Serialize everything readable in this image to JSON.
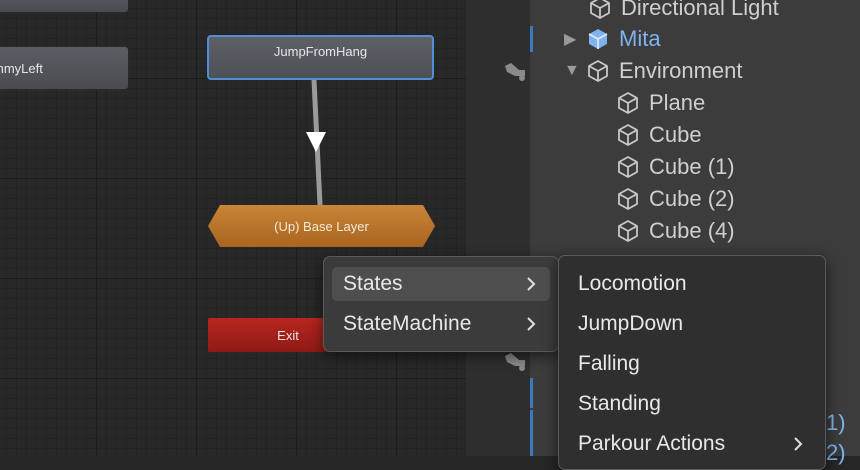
{
  "animator": {
    "nodes": {
      "top_partial": "",
      "left_partial": "mmyLeft",
      "jump_from_hang": "JumpFromHang",
      "base_layer": "(Up) Base Layer",
      "exit": "Exit"
    }
  },
  "hierarchy": {
    "items": [
      {
        "label": "Directional Light"
      },
      {
        "label": "Mita"
      },
      {
        "label": "Environment"
      },
      {
        "label": "Plane"
      },
      {
        "label": "Cube"
      },
      {
        "label": "Cube (1)"
      },
      {
        "label": "Cube (2)"
      },
      {
        "label": "Cube (4)"
      }
    ],
    "edge_fragments": [
      "1)",
      "2)"
    ],
    "colors": {
      "prefab_blue": "#7fb2ee",
      "selection_bar": "#3a79c2"
    }
  },
  "context_menu": {
    "items": [
      {
        "label": "States"
      },
      {
        "label": "StateMachine"
      }
    ],
    "submenu": {
      "items": [
        {
          "label": "Locomotion"
        },
        {
          "label": "JumpDown"
        },
        {
          "label": "Falling"
        },
        {
          "label": "Standing"
        },
        {
          "label": "Parkour Actions"
        }
      ]
    }
  },
  "colors": {
    "base_layer": "#c98538",
    "exit": "#b8261f",
    "selected_outline": "#4f8fd6"
  }
}
